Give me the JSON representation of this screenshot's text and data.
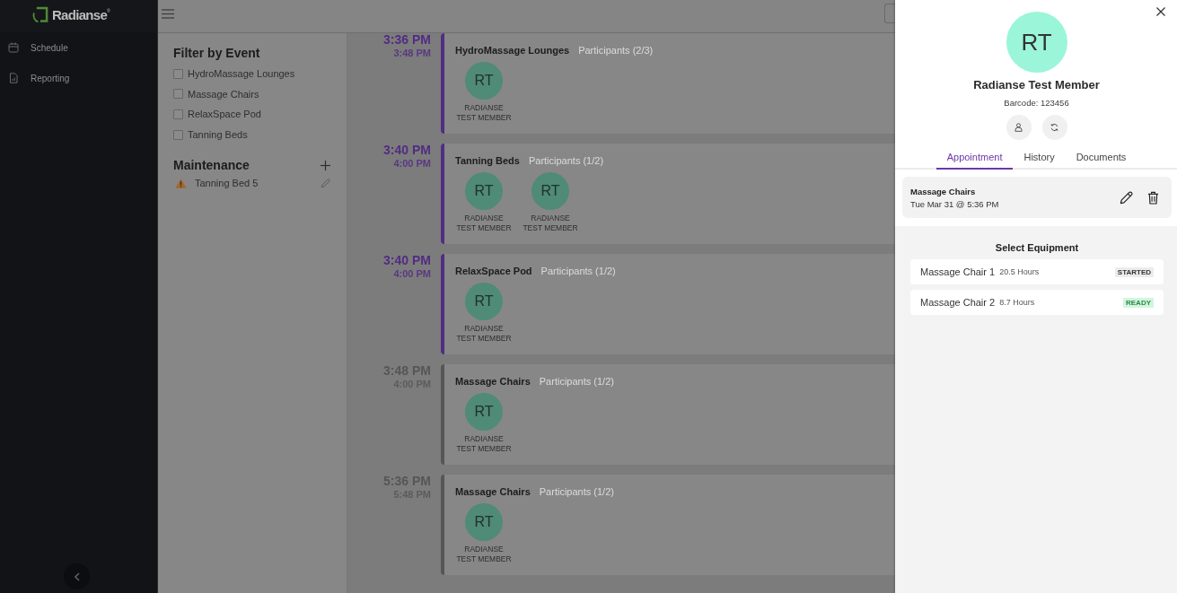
{
  "sidebar": {
    "logo": "Radianse$^{®}$",
    "items": [
      {
        "label": "Schedule"
      },
      {
        "label": "Reporting"
      }
    ]
  },
  "filter": {
    "title": "Filter by Event",
    "options": [
      {
        "label": "HydroMassage Lounges",
        "checked": false
      },
      {
        "label": "Massage Chairs",
        "checked": false
      },
      {
        "label": "RelaxSpace Pod",
        "checked": false
      },
      {
        "label": "Tanning Beds",
        "checked": false
      }
    ]
  },
  "maintenance": {
    "title": "Maintenance",
    "items": [
      {
        "label": "Tanning Bed 5"
      }
    ]
  },
  "events": [
    {
      "start": "3:36 PM",
      "end": "3:48 PM",
      "color": "#522d82",
      "title": "HydroMassage Lounges",
      "participants_label": "Participants (2/3)",
      "participants": [
        {
          "initials": "RT",
          "name": "RADIANSE TEST MEMBER"
        }
      ]
    },
    {
      "start": "3:40 PM",
      "end": "4:00 PM",
      "color": "#522d82",
      "title": "Tanning Beds",
      "participants_label": "Participants (1/2)",
      "participants": [
        {
          "initials": "RT",
          "name": "RADIANSE TEST MEMBER"
        },
        {
          "initials": "RT",
          "name": "RADIANSE TEST MEMBER"
        }
      ]
    },
    {
      "start": "3:40 PM",
      "end": "4:00 PM",
      "color": "#522d82",
      "title": "RelaxSpace Pod",
      "participants_label": "Participants (1/2)",
      "participants": [
        {
          "initials": "RT",
          "name": "RADIANSE TEST MEMBER"
        }
      ]
    },
    {
      "start": "3:48 PM",
      "end": "4:00 PM",
      "color": "#565656",
      "title": "Massage Chairs",
      "participants_label": "Participants (1/2)",
      "participants": [
        {
          "initials": "RT",
          "name": "RADIANSE TEST MEMBER"
        }
      ]
    },
    {
      "start": "5:36 PM",
      "end": "5:48 PM",
      "color": "#565656",
      "title": "Massage Chairs",
      "participants_label": "Participants (1/2)",
      "participants": [
        {
          "initials": "RT",
          "name": "RADIANSE TEST MEMBER"
        }
      ]
    }
  ],
  "member_panel": {
    "initials": "RT",
    "name": "Radianse Test Member",
    "barcode": "Barcode: 123456",
    "tabs": [
      {
        "label": "Appointment",
        "selected": true
      },
      {
        "label": "History",
        "selected": false
      },
      {
        "label": "Documents",
        "selected": false
      }
    ],
    "appointment": {
      "title": "Massage Chairs",
      "when": "Tue Mar 31 @ 5:36 PM"
    },
    "equipment": {
      "title": "Select Equipment",
      "items": [
        {
          "name": "Massage Chair 1",
          "hours": "20.5 Hours",
          "status": "STARTED",
          "kind": "started"
        },
        {
          "name": "Massage Chair 2",
          "hours": "8.7 Hours",
          "status": "READY",
          "kind": "ready"
        }
      ]
    }
  }
}
